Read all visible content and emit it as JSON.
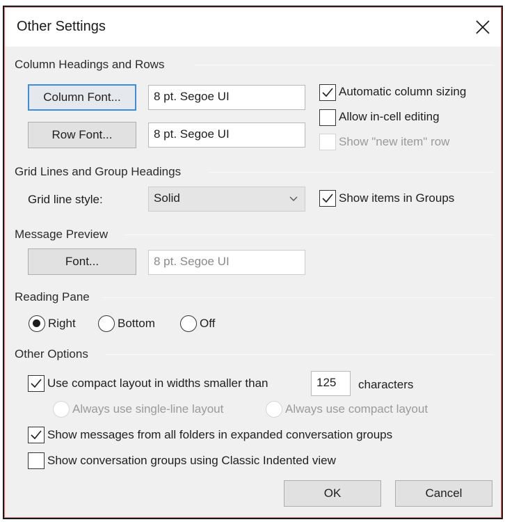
{
  "dialog": {
    "title": "Other Settings",
    "close_icon": "close-icon"
  },
  "column_headings": {
    "label": "Column Headings and Rows",
    "column_font_button": "Column Font...",
    "column_font_value": "8 pt. Segoe UI",
    "row_font_button": "Row Font...",
    "row_font_value": "8 pt. Segoe UI",
    "automatic_column_sizing": {
      "label": "Automatic column sizing",
      "checked": true,
      "enabled": true
    },
    "allow_in_cell_editing": {
      "label": "Allow in-cell editing",
      "checked": false,
      "enabled": true
    },
    "show_new_item_row": {
      "label": "Show \"new item\" row",
      "checked": false,
      "enabled": false
    }
  },
  "grid_lines": {
    "label": "Grid Lines and Group Headings",
    "grid_line_style_label": "Grid line style:",
    "grid_line_style_value": "Solid",
    "show_items_in_groups": {
      "label": "Show items in Groups",
      "checked": true,
      "enabled": true
    }
  },
  "message_preview": {
    "label": "Message Preview",
    "font_button": "Font...",
    "font_value": "8 pt. Segoe UI"
  },
  "reading_pane": {
    "label": "Reading Pane",
    "options": [
      {
        "label": "Right",
        "selected": true
      },
      {
        "label": "Bottom",
        "selected": false
      },
      {
        "label": "Off",
        "selected": false
      }
    ]
  },
  "other_options": {
    "label": "Other Options",
    "compact_layout": {
      "label": "Use compact layout in widths smaller than",
      "checked": true,
      "value": "125",
      "suffix": "characters"
    },
    "layout_options": [
      {
        "label": "Always use single-line layout",
        "selected": false,
        "enabled": false
      },
      {
        "label": "Always use compact layout",
        "selected": false,
        "enabled": false
      }
    ],
    "show_all_folders": {
      "label": "Show messages from all folders in expanded conversation groups",
      "checked": true
    },
    "classic_indented": {
      "label": "Show conversation groups using Classic Indented view",
      "checked": false
    }
  },
  "footer": {
    "ok_label": "OK",
    "cancel_label": "Cancel"
  }
}
